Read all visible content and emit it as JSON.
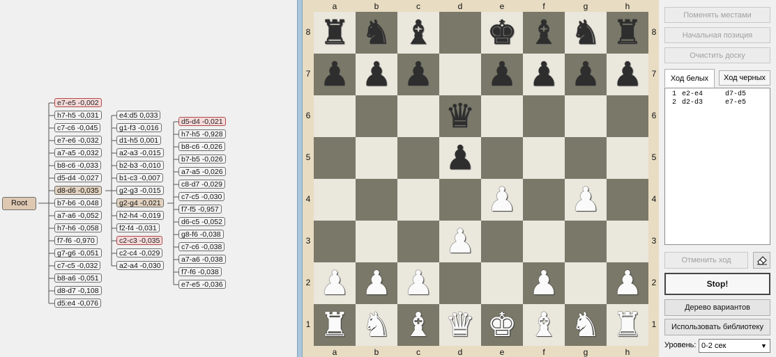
{
  "tree": {
    "root": "Root",
    "col1": [
      "e7-e5 -0,002",
      "h7-h5 -0,031",
      "c7-c6 -0,045",
      "e7-e6 -0,032",
      "a7-a5 -0,032",
      "b8-c6 -0,033",
      "d5-d4 -0,027",
      "d8-d6 -0,035",
      "b7-b6 -0,048",
      "a7-a6 -0,052",
      "h7-h6 -0,058",
      "f7-f6 -0,970",
      "g7-g6 -0,051",
      "c7-c5 -0,032",
      "b8-a6 -0,051",
      "d8-d7 -0,108",
      "d5:e4 -0,076"
    ],
    "col2": [
      "e4:d5 0,033",
      "g1-f3 -0,016",
      "d1-h5 0,001",
      "a2-a3 -0,015",
      "b2-b3 -0,010",
      "b1-c3 -0,007",
      "g2-g3 -0,015",
      "g2-g4 -0,021",
      "h2-h4 -0,019",
      "f2-f4 -0,031",
      "c2-c3 -0,035",
      "c2-c4 -0,029",
      "a2-a4 -0,030"
    ],
    "col3": [
      "d5-d4 -0,021",
      "h7-h5 -0,928",
      "b8-c6 -0,026",
      "b7-b5 -0,026",
      "a7-a5 -0,026",
      "c8-d7 -0,029",
      "c7-c5 -0,030",
      "f7-f5 -0,957",
      "d6-c5 -0,052",
      "g8-f6 -0,038",
      "c7-c6 -0,038",
      "a7-a6 -0,038",
      "f7-f6 -0,038",
      "e7-e5 -0,036"
    ]
  },
  "board": {
    "files": [
      "a",
      "b",
      "c",
      "d",
      "e",
      "f",
      "g",
      "h"
    ],
    "ranks": [
      "8",
      "7",
      "6",
      "5",
      "4",
      "3",
      "2",
      "1"
    ],
    "position": [
      [
        "r",
        "n",
        "b",
        "",
        "k",
        "b",
        "n",
        "r"
      ],
      [
        "p",
        "p",
        "p",
        "",
        "p",
        "p",
        "p",
        "p"
      ],
      [
        "",
        "",
        "",
        "q",
        "",
        "",
        "",
        ""
      ],
      [
        "",
        "",
        "",
        "p",
        "",
        "",
        "",
        ""
      ],
      [
        "",
        "",
        "",
        "",
        "P",
        "",
        "P",
        ""
      ],
      [
        "",
        "",
        "",
        "P",
        "",
        "",
        "",
        ""
      ],
      [
        "P",
        "P",
        "P",
        "",
        "",
        "P",
        "",
        "P"
      ],
      [
        "R",
        "N",
        "B",
        "Q",
        "K",
        "B",
        "N",
        "R"
      ]
    ]
  },
  "controls": {
    "swap_sides": "Поменять местами",
    "initial_position": "Начальная позиция",
    "clear_board": "Очистить доску",
    "tab_white": "Ход белых",
    "tab_black": "Ход черных",
    "moves": [
      {
        "n": "1",
        "w": "e2-e4",
        "b": "d7-d5"
      },
      {
        "n": "2",
        "w": "d2-d3",
        "b": "e7-e5"
      }
    ],
    "undo": "Отменить ход",
    "stop": "Stop!",
    "variant_tree": "Дерево вариантов",
    "use_library": "Использовать библиотеку",
    "level_label": "Уровень:",
    "level_value": "0-2 сек"
  }
}
